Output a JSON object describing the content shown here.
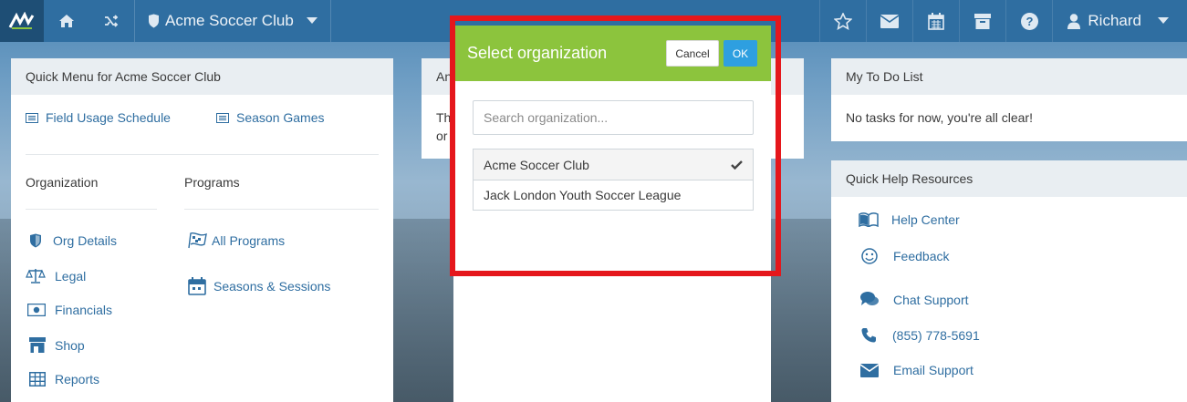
{
  "topbar": {
    "org_name": "Acme Soccer Club",
    "user_name": "Richard",
    "icons": [
      "home-icon",
      "shuffle-icon",
      "shield-icon",
      "star-icon",
      "mail-icon",
      "calendar-icon",
      "archive-icon",
      "help-icon",
      "user-icon"
    ]
  },
  "quick_menu": {
    "title": "Quick Menu for Acme Soccer Club",
    "links": [
      "Field Usage Schedule",
      "Season Games"
    ],
    "organization_heading": "Organization",
    "programs_heading": "Programs",
    "org_items": [
      "Org Details",
      "Legal",
      "Financials",
      "Shop",
      "Reports"
    ],
    "program_items": [
      "All Programs",
      "Seasons & Sessions"
    ]
  },
  "announcements": {
    "title_fragment": "An",
    "text_line1": "Th",
    "text_line2": "or"
  },
  "todo": {
    "title": "My To Do List",
    "message": "No tasks for now, you're all clear!"
  },
  "help": {
    "title": "Quick Help Resources",
    "items": [
      "Help Center",
      "Feedback",
      "Chat Support",
      "(855) 778-5691",
      "Email Support"
    ]
  },
  "modal": {
    "title": "Select organization",
    "cancel_label": "Cancel",
    "ok_label": "OK",
    "search_placeholder": "Search organization...",
    "organizations": [
      "Acme Soccer Club",
      "Jack London Youth Soccer League"
    ],
    "selected_index": 0
  },
  "colors": {
    "topbar": "#2f6ea1",
    "link": "#2f6ea1",
    "modal_header": "#8cc43d",
    "ok_button": "#2e9fe0",
    "highlight": "#e5171c"
  }
}
